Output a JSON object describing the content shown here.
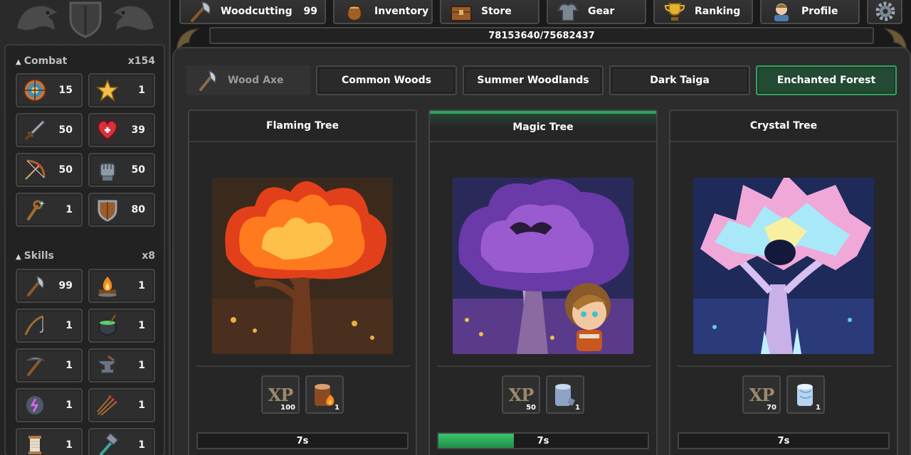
{
  "nav": {
    "items": [
      {
        "label": "Woodcutting",
        "level": "99",
        "icon": "axe-icon"
      },
      {
        "label": "Inventory",
        "icon": "bag-icon"
      },
      {
        "label": "Store",
        "icon": "chest-icon"
      },
      {
        "label": "Gear",
        "icon": "armor-icon"
      },
      {
        "label": "Ranking",
        "icon": "trophy-icon"
      },
      {
        "label": "Profile",
        "icon": "avatar-icon"
      }
    ],
    "settings_icon": "gear-icon"
  },
  "xp_bar": {
    "text": "78153640/75682437"
  },
  "sidebar": {
    "combat": {
      "title": "Combat",
      "count": "x154",
      "stats": [
        {
          "icon": "target-icon",
          "value": "15"
        },
        {
          "icon": "star-icon",
          "value": "1"
        },
        {
          "icon": "sword-icon",
          "value": "50"
        },
        {
          "icon": "heart-icon",
          "value": "39"
        },
        {
          "icon": "bow-icon",
          "value": "50"
        },
        {
          "icon": "fist-icon",
          "value": "50"
        },
        {
          "icon": "wand-icon",
          "value": "1"
        },
        {
          "icon": "shield-icon",
          "value": "80"
        }
      ]
    },
    "skills": {
      "title": "Skills",
      "count": "x8",
      "stats": [
        {
          "icon": "axe-icon",
          "value": "99"
        },
        {
          "icon": "campfire-icon",
          "value": "1"
        },
        {
          "icon": "fishing-rod-icon",
          "value": "1"
        },
        {
          "icon": "cauldron-icon",
          "value": "1"
        },
        {
          "icon": "pickaxe-icon",
          "value": "1"
        },
        {
          "icon": "anvil-icon",
          "value": "1"
        },
        {
          "icon": "rune-stone-icon",
          "value": "1"
        },
        {
          "icon": "arrows-icon",
          "value": "1"
        },
        {
          "icon": "thread-spool-icon",
          "value": "1"
        },
        {
          "icon": "hammer-icon",
          "value": "1"
        }
      ]
    }
  },
  "tabs": {
    "tool": {
      "label": "Wood Axe",
      "icon": "axe-icon"
    },
    "areas": [
      "Common Woods",
      "Summer Woodlands",
      "Dark Taiga",
      "Enchanted Forest"
    ],
    "active": "Enchanted Forest"
  },
  "trees": [
    {
      "name": "Flaming Tree",
      "xp": "100",
      "item_qty": "1",
      "item_icon": "fire-log-icon",
      "time": "7s",
      "progress": 0,
      "active": false
    },
    {
      "name": "Magic Tree",
      "xp": "50",
      "item_qty": "1",
      "item_icon": "magic-log-icon",
      "time": "7s",
      "progress": 0.36,
      "active": true
    },
    {
      "name": "Crystal Tree",
      "xp": "70",
      "item_qty": "1",
      "item_icon": "crystal-log-icon",
      "time": "7s",
      "progress": 0,
      "active": false
    }
  ],
  "reward_label": "XP",
  "colors": {
    "accent": "#2fa35d",
    "panel": "#2c2c2c",
    "progress": "#3cc46e"
  }
}
